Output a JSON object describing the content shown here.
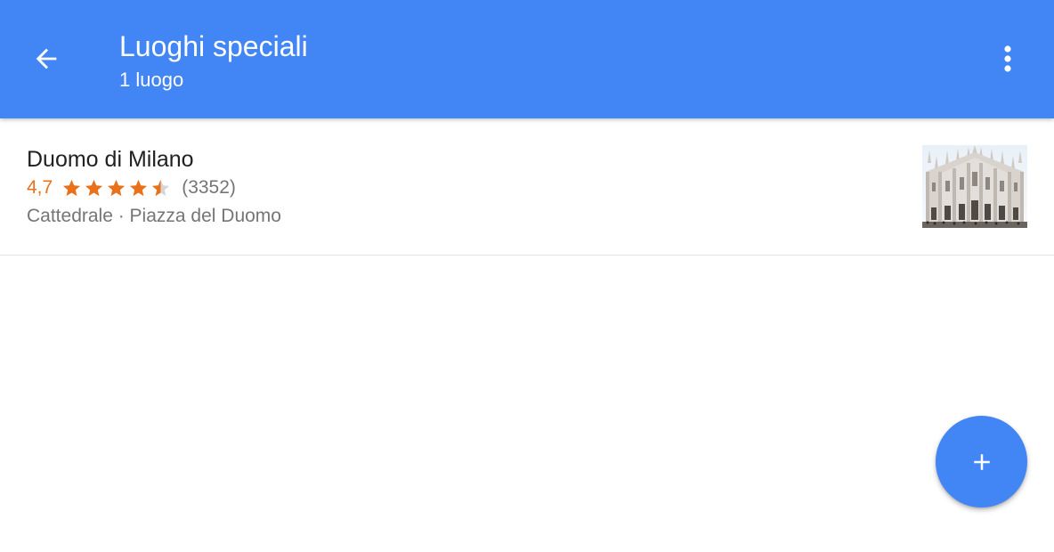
{
  "app_bar": {
    "title": "Luoghi speciali",
    "subtitle": "1 luogo",
    "back_icon": "arrow-back-icon",
    "menu_icon": "more-vert-icon",
    "background_color": "#4285f4"
  },
  "places": [
    {
      "name": "Duomo di Milano",
      "rating": "4,7",
      "rating_stars": 4.7,
      "review_count": "(3352)",
      "details": "Cattedrale · Piazza del Duomo",
      "thumbnail": "cathedral-photo"
    }
  ],
  "fab": {
    "icon": "plus-icon",
    "color": "#4285f4"
  },
  "colors": {
    "rating": "#e8711a",
    "secondary_text": "#757575",
    "primary_text": "#212121"
  }
}
